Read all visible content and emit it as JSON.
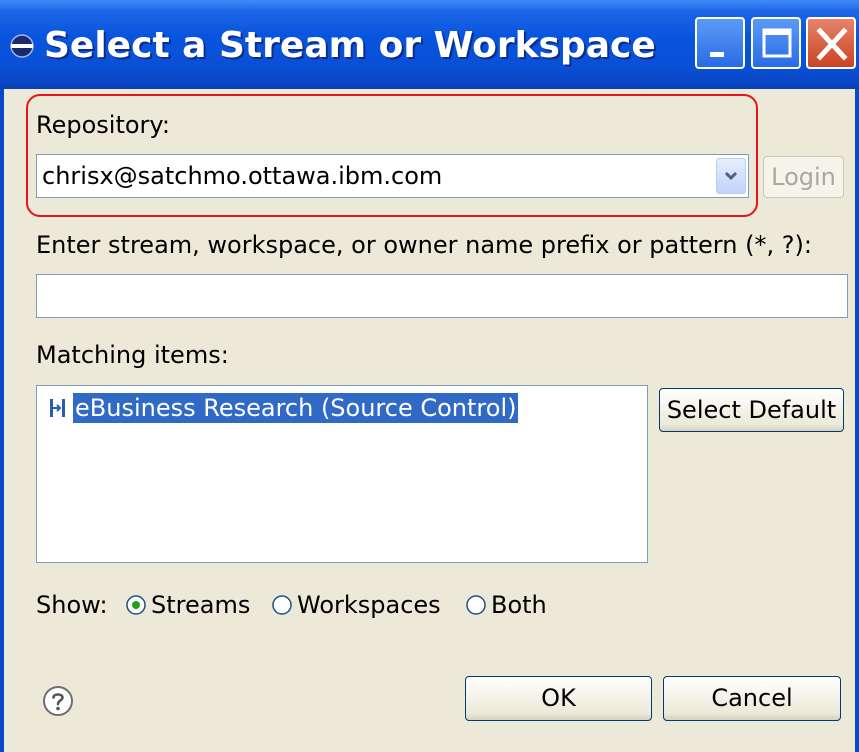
{
  "window": {
    "title": "Select a Stream or Workspace"
  },
  "repository": {
    "label": "Repository:",
    "selected": "chrisx@satchmo.ottawa.ibm.com",
    "login_label": "Login"
  },
  "filter": {
    "label": "Enter stream, workspace, or owner name prefix or pattern (*, ?):",
    "value": ""
  },
  "matching": {
    "label": "Matching items:",
    "items": [
      {
        "label": "eBusiness Research (Source Control)",
        "selected": true
      }
    ],
    "select_default_label": "Select Default"
  },
  "show": {
    "label": "Show:",
    "options": [
      {
        "label": "Streams",
        "checked": true
      },
      {
        "label": "Workspaces",
        "checked": false
      },
      {
        "label": "Both",
        "checked": false
      }
    ]
  },
  "footer": {
    "ok_label": "OK",
    "cancel_label": "Cancel"
  },
  "colors": {
    "titlebar": "#0855dd",
    "highlight_border": "#e8141e",
    "selection": "#316ac5"
  }
}
